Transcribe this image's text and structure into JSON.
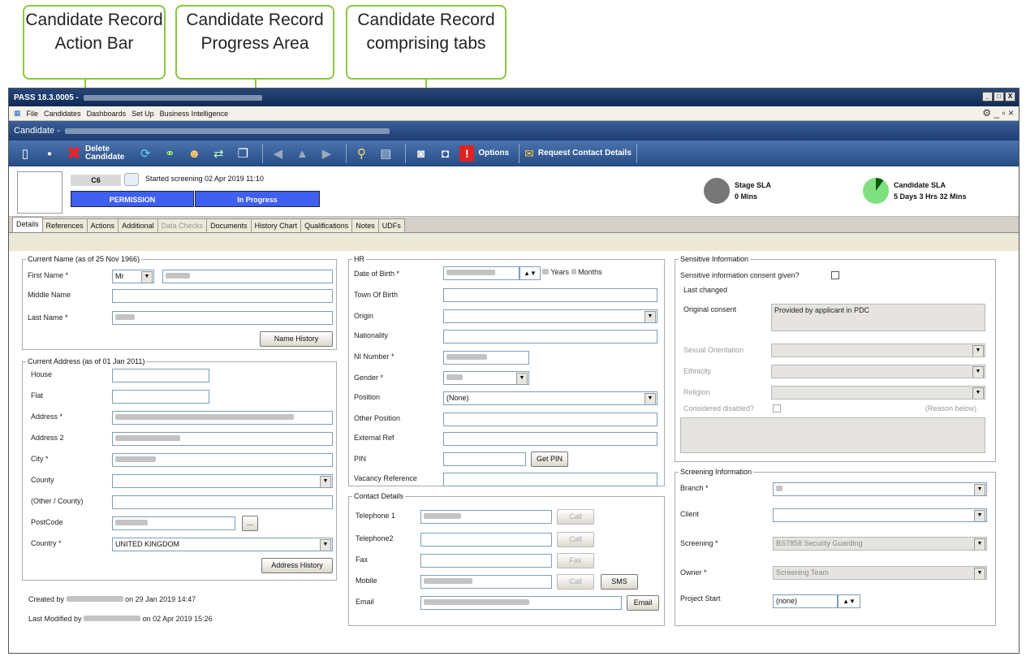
{
  "callouts": [
    {
      "text": "Candidate Record Action Bar"
    },
    {
      "text": "Candidate Record Progress Area"
    },
    {
      "text": "Candidate Record comprising tabs"
    }
  ],
  "window": {
    "title": "PASS 18.3.0005 -",
    "controls": [
      "_",
      "□",
      "X"
    ]
  },
  "menu": [
    "File",
    "Candidates",
    "Dashboards",
    "Set Up",
    "Business Intelligence"
  ],
  "candidate_bar": {
    "label": "Candidate -"
  },
  "toolbar": {
    "delete_label_1": "Delete",
    "delete_label_2": "Candidate",
    "options_label": "Options",
    "request_label": "Request Contact Details",
    "icons": [
      "new-icon",
      "save-icon",
      "delete-icon",
      "refresh-icon",
      "link-icon",
      "users-icon",
      "transfer-icon",
      "copy-icon",
      "back-icon",
      "up-icon",
      "forward-icon",
      "search-icon",
      "chat-icon",
      "camera-icon",
      "camera2-icon",
      "options-icon",
      "request-icon"
    ]
  },
  "progress": {
    "code": "C6",
    "started": "Started screening 02 Apr 2019 11:10",
    "stage1": "PERMISSION",
    "stage2": "In Progress",
    "stage_sla_label": "Stage SLA",
    "stage_sla_value": "0 Mins",
    "cand_sla_label": "Candidate SLA",
    "cand_sla_value": "5 Days 3 Hrs 32 Mins"
  },
  "tabs": [
    "Details",
    "References",
    "Actions",
    "Additional",
    "Data Checks",
    "Documents",
    "History Chart",
    "Qualifications",
    "Notes",
    "UDFs"
  ],
  "name_section": {
    "legend": "Current Name (as of 25 Nov 1966)",
    "first_name": "First Name *",
    "title_value": "Mr",
    "middle_name": "Middle Name",
    "last_name": "Last Name *",
    "history_button": "Name History"
  },
  "address_section": {
    "legend": "Current Address (as of 01 Jan 2011)",
    "house": "House",
    "flat": "Flat",
    "address": "Address *",
    "address2": "Address 2",
    "city": "City *",
    "county": "County",
    "other_county": "(Other / County)",
    "postcode": "PostCode",
    "postcode_btn": "...",
    "country": "Country *",
    "country_value": "UNITED KINGDOM",
    "history_button": "Address History"
  },
  "audit": {
    "created": "Created by",
    "created_on": "on 29 Jan 2019 14:47",
    "modified": "Last Modified by",
    "modified_on": "on 02 Apr 2019 15:26"
  },
  "hr": {
    "legend": "HR",
    "dob": "Date of Birth *",
    "years": "Years",
    "months": "Months",
    "town": "Town Of Birth",
    "origin": "Origin",
    "nationality": "Nationality",
    "ni": "NI Number *",
    "gender": "Gender *",
    "position": "Position",
    "position_value": "(None)",
    "other_position": "Other Position",
    "external_ref": "External Ref",
    "pin": "PIN",
    "get_pin": "Get PIN",
    "vacancy": "Vacancy Reference"
  },
  "contact": {
    "legend": "Contact Details",
    "tel1": "Telephone 1",
    "tel2": "Telephone2",
    "fax": "Fax",
    "mobile": "Mobile",
    "email": "Email",
    "call": "Call",
    "fax_btn": "Fax",
    "sms": "SMS",
    "email_btn": "Email"
  },
  "sensitive": {
    "legend": "Sensitive Information",
    "consent": "Sensitive information consent given?",
    "last_changed": "Last changed",
    "original_consent": "Original consent",
    "consent_value": "Provided by applicant in PDC",
    "sexual_orientation": "Sexual Orientation",
    "ethnicity": "Ethnicity",
    "religion": "Religion",
    "disabled": "Considered disabled?",
    "reason": "(Reason below)"
  },
  "screening": {
    "legend": "Screening Information",
    "branch": "Branch *",
    "client": "Client",
    "screening": "Screening *",
    "screening_value": "BS7858 Security Guarding",
    "owner": "Owner *",
    "owner_value": "Screening Team",
    "project_start": "Project Start",
    "project_value": "(none)"
  },
  "colors": {
    "accent": "#8dc63f",
    "toolbar": "#355d9a",
    "stage": "#3f5ff0"
  }
}
